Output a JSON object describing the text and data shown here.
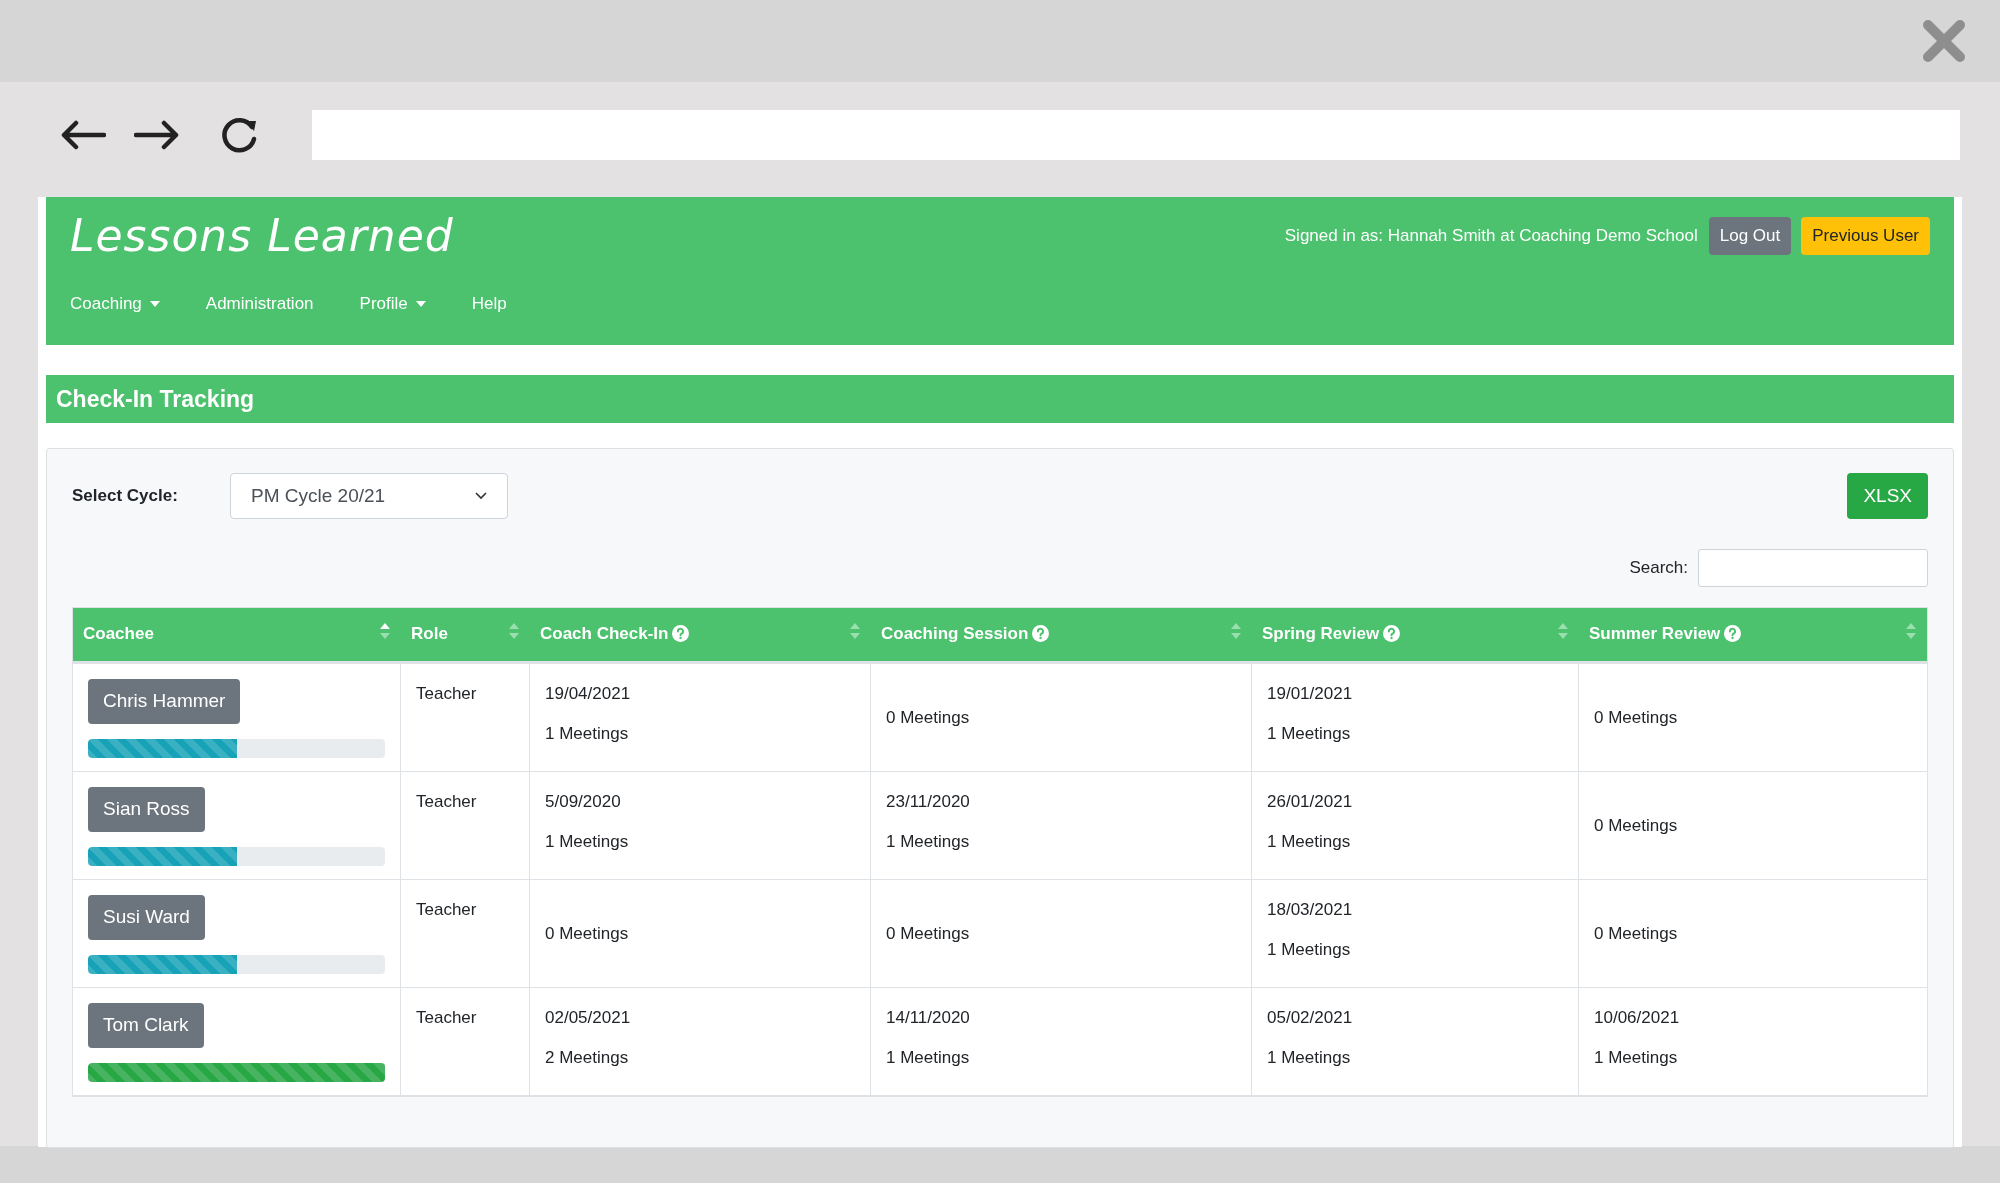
{
  "app": {
    "title": "Lessons Learned",
    "signed_in": "Signed in as: Hannah Smith at Coaching Demo School",
    "buttons": [
      {
        "label": "Log Out",
        "kind": "secondary"
      },
      {
        "label": "Previous User",
        "kind": "warning"
      }
    ]
  },
  "nav": [
    {
      "label": "Coaching",
      "dropdown": true
    },
    {
      "label": "Administration",
      "dropdown": false
    },
    {
      "label": "Profile",
      "dropdown": true
    },
    {
      "label": "Help",
      "dropdown": false
    }
  ],
  "page_title": "Check-In Tracking",
  "cycle": {
    "label": "Select Cycle:",
    "value": "PM Cycle 20/21"
  },
  "export_button": "XLSX",
  "search": {
    "label": "Search:"
  },
  "table": {
    "columns": [
      {
        "label": "Coachee",
        "help": false,
        "sorted": true
      },
      {
        "label": "Role",
        "help": false,
        "sorted": false
      },
      {
        "label": "Coach Check-In",
        "help": true,
        "sorted": false
      },
      {
        "label": "Coaching Session",
        "help": true,
        "sorted": false
      },
      {
        "label": "Spring Review",
        "help": true,
        "sorted": false
      },
      {
        "label": "Summer Review",
        "help": true,
        "sorted": false
      }
    ],
    "rows": [
      {
        "cells": [
          {
            "kind": "coachee",
            "name": "Chris Hammer",
            "level": 0.5,
            "color": "#17a2b8"
          },
          {
            "kind": "text",
            "text": "Teacher"
          },
          {
            "kind": "meetings",
            "date": "19/04/2021",
            "meetings": "1 Meetings"
          },
          {
            "kind": "meetings",
            "meetings": "0 Meetings"
          },
          {
            "kind": "meetings",
            "date": "19/01/2021",
            "meetings": "1 Meetings"
          },
          {
            "kind": "meetings",
            "meetings": "0 Meetings"
          }
        ]
      },
      {
        "cells": [
          {
            "kind": "coachee",
            "name": "Sian Ross",
            "level": 0.5,
            "color": "#17a2b8"
          },
          {
            "kind": "text",
            "text": "Teacher"
          },
          {
            "kind": "meetings",
            "date": "5/09/2020",
            "meetings": "1 Meetings"
          },
          {
            "kind": "meetings",
            "date": "23/11/2020",
            "meetings": "1 Meetings"
          },
          {
            "kind": "meetings",
            "date": "26/01/2021",
            "meetings": "1 Meetings"
          },
          {
            "kind": "meetings",
            "meetings": "0 Meetings"
          }
        ]
      },
      {
        "cells": [
          {
            "kind": "coachee",
            "name": "Susi Ward",
            "level": 0.5,
            "color": "#17a2b8"
          },
          {
            "kind": "text",
            "text": "Teacher"
          },
          {
            "kind": "meetings",
            "meetings": "0 Meetings"
          },
          {
            "kind": "meetings",
            "meetings": "0 Meetings"
          },
          {
            "kind": "meetings",
            "date": "18/03/2021",
            "meetings": "1 Meetings"
          },
          {
            "kind": "meetings",
            "meetings": "0 Meetings"
          }
        ]
      },
      {
        "cells": [
          {
            "kind": "coachee",
            "name": "Tom Clark",
            "level": 1,
            "color": "#28a745"
          },
          {
            "kind": "text",
            "text": "Teacher"
          },
          {
            "kind": "meetings",
            "date": "02/05/2021",
            "meetings": "2 Meetings"
          },
          {
            "kind": "meetings",
            "date": "14/11/2020",
            "meetings": "1 Meetings"
          },
          {
            "kind": "meetings",
            "date": "05/02/2021",
            "meetings": "1 Meetings"
          },
          {
            "kind": "meetings",
            "date": "10/06/2021",
            "meetings": "1 Meetings"
          }
        ]
      }
    ]
  }
}
